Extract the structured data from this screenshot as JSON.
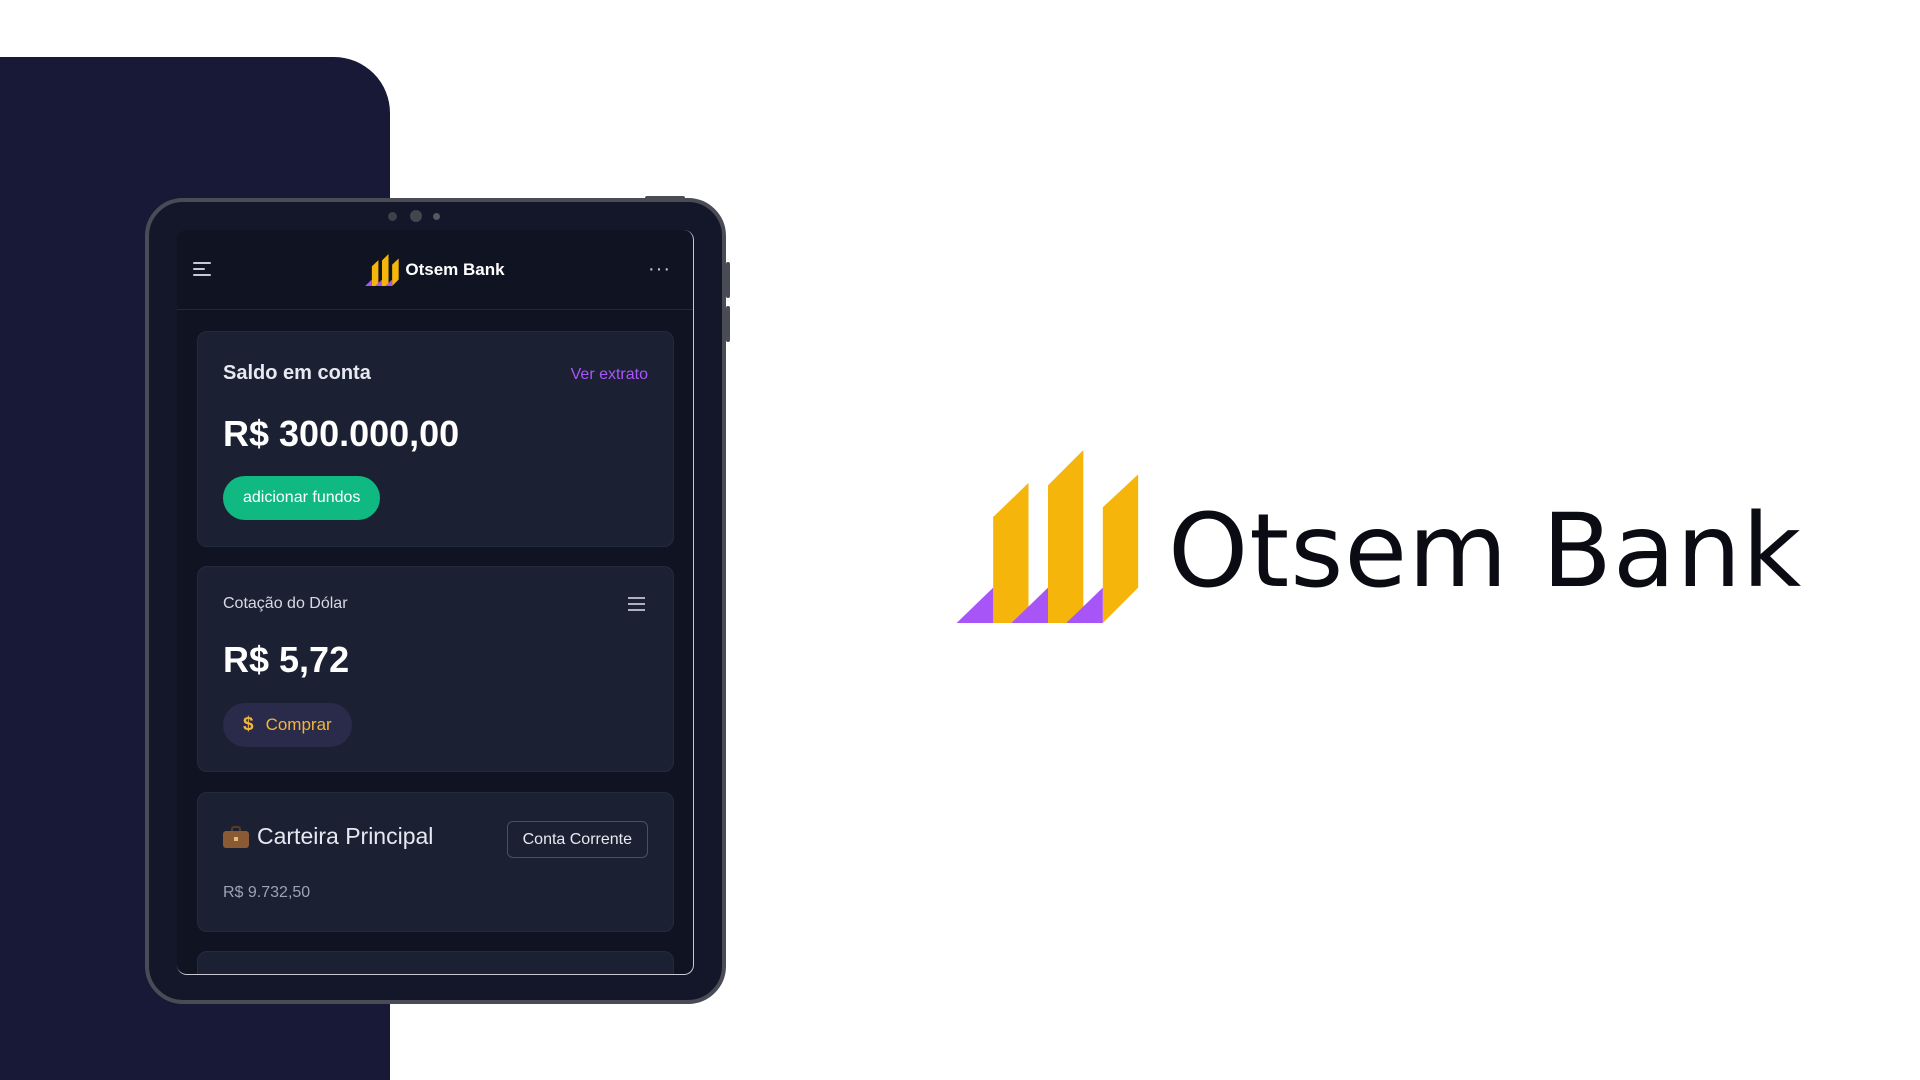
{
  "brand": {
    "name": "Otsem Bank",
    "colors": {
      "gold": "#f5b50a",
      "purple": "#a855f7",
      "dark": "#181837",
      "green": "#10b981"
    }
  },
  "app": {
    "header": {
      "brand_name": "Otsem Bank",
      "menu_icon": "hamburger-icon",
      "more_icon": "more-horizontal-icon"
    },
    "balance_card": {
      "title": "Saldo em conta",
      "link": "Ver extrato",
      "amount": "R$ 300.000,00",
      "button": "adicionar fundos"
    },
    "dollar_card": {
      "title": "Cotação do Dólar",
      "amount": "R$ 5,72",
      "button": "Comprar",
      "button_icon": "$"
    },
    "wallet_card": {
      "title": "Carteira Principal",
      "badge": "Conta Corrente",
      "amount": "R$ 9.732,50"
    }
  },
  "logo_text": "Otsem Bank"
}
